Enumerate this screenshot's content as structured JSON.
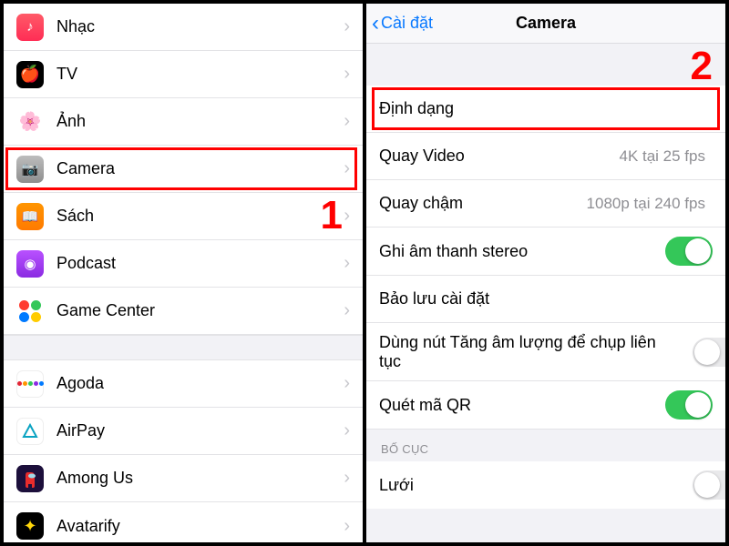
{
  "left": {
    "items": [
      {
        "label": "Nhạc"
      },
      {
        "label": "TV"
      },
      {
        "label": "Ảnh"
      },
      {
        "label": "Camera"
      },
      {
        "label": "Sách"
      },
      {
        "label": "Podcast"
      },
      {
        "label": "Game Center"
      }
    ],
    "apps": [
      {
        "label": "Agoda"
      },
      {
        "label": "AirPay"
      },
      {
        "label": "Among Us"
      },
      {
        "label": "Avatarify"
      }
    ],
    "marker": "1"
  },
  "right": {
    "back": "Cài đặt",
    "title": "Camera",
    "marker": "2",
    "rows": {
      "format": "Định dạng",
      "recordVideo": {
        "label": "Quay Video",
        "value": "4K tại 25 fps"
      },
      "slomo": {
        "label": "Quay chậm",
        "value": "1080p tại 240 fps"
      },
      "stereo": {
        "label": "Ghi âm thanh stereo",
        "on": true
      },
      "preserve": {
        "label": "Bảo lưu cài đặt"
      },
      "burst": {
        "label": "Dùng nút Tăng âm lượng để chụp liên tục",
        "on": false
      },
      "qr": {
        "label": "Quét mã QR",
        "on": true
      },
      "sectionLayout": "BỐ CỤC",
      "grid": {
        "label": "Lưới",
        "on": false
      }
    }
  }
}
